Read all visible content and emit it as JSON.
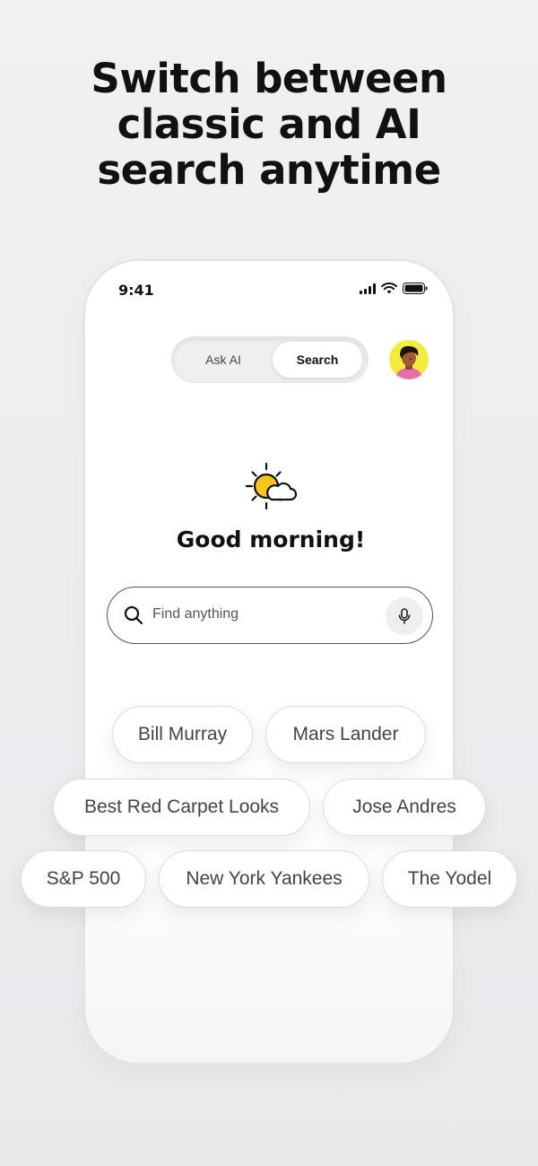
{
  "headline": {
    "line1": "Switch between",
    "line2": "classic and AI",
    "line3": "search anytime"
  },
  "status_bar": {
    "time": "9:41",
    "icons": [
      "signal-icon",
      "wifi-icon",
      "battery-icon"
    ]
  },
  "mode_toggle": {
    "options": [
      {
        "label": "Ask AI",
        "selected": false
      },
      {
        "label": "Search",
        "selected": true
      }
    ]
  },
  "avatar": {
    "icon": "user-avatar"
  },
  "weather": {
    "icon": "partly-sunny-icon",
    "accent": "#f5c518"
  },
  "greeting": "Good morning!",
  "search": {
    "placeholder": "Find anything",
    "icons": [
      "search-icon",
      "microphone-icon"
    ]
  },
  "suggestions": [
    [
      "Bill Murray",
      "Mars Lander"
    ],
    [
      "Best Red Carpet Looks",
      "Jose Andres"
    ],
    [
      "S&P 500",
      "New York Yankees",
      "The Yodel"
    ]
  ]
}
